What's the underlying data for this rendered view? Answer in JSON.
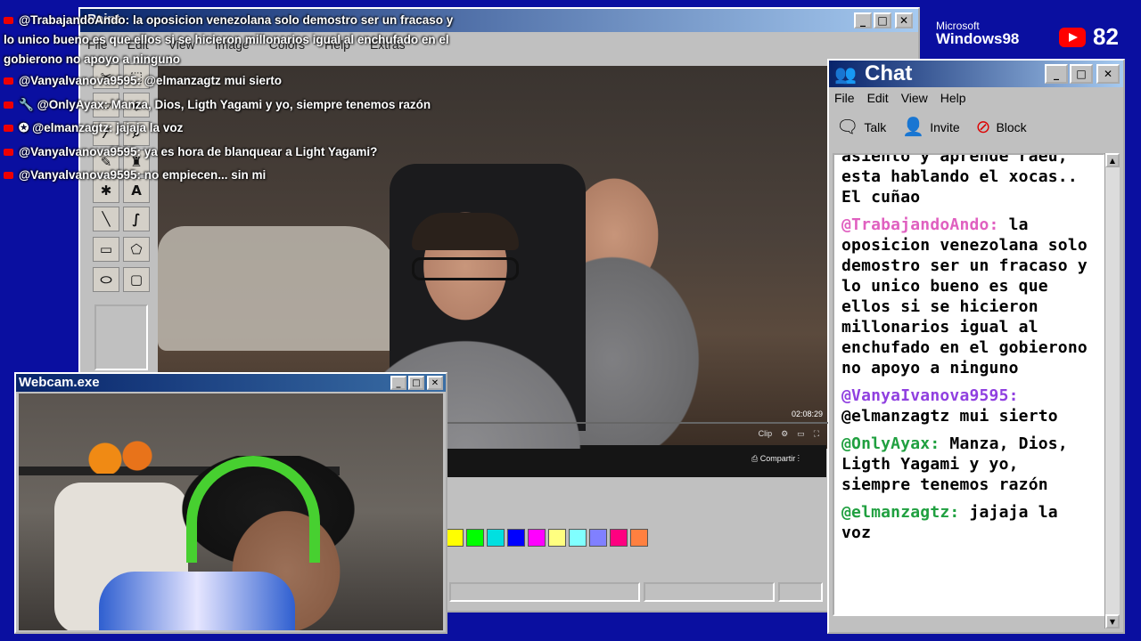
{
  "paint": {
    "title": "Paint",
    "menu": [
      "File",
      "Edit",
      "View",
      "Image",
      "Colors",
      "Help",
      "Extras"
    ],
    "stream": {
      "timecode": "02:08:29",
      "clip_label": "Clip",
      "share_label": "Compartir"
    },
    "palette": [
      "#ffff00",
      "#00ff00",
      "#00e0e0",
      "#0000ff",
      "#ff00ff",
      "#ffff80",
      "#80ffff",
      "#8080ff",
      "#ff0080",
      "#ff8040"
    ]
  },
  "overlay": {
    "messages": [
      {
        "user": "@TrabajandoAndo:",
        "text": "la oposicion venezolana solo demostro ser un fracaso y lo unico bueno es que ellos si se hicieron millonarios igual al enchufado en el gobierono no apoyo a ninguno"
      },
      {
        "user": "@Vanyalvanova9595:",
        "text": "@elmanzagtz mui sierto"
      },
      {
        "user": "@OnlyAyax:",
        "text": "Manza, Dios, Ligth Yagami y yo, siempre tenemos razón"
      },
      {
        "user": "@elmanzagtz:",
        "text": "jajaja la voz"
      },
      {
        "user": "@Vanyalvanova9595:",
        "text": "ya es hora de blanquear a Light Yagami?"
      },
      {
        "user": "@Vanyalvanova9595:",
        "text": "no empiecen... sin mi"
      }
    ]
  },
  "branding": {
    "microsoft": "Microsoft",
    "windows": "Windows98",
    "viewer_count": "82"
  },
  "chat": {
    "title": "Chat",
    "menu": [
      "File",
      "Edit",
      "View",
      "Help"
    ],
    "toolbar": {
      "talk": "Talk",
      "invite": "Invite",
      "block": "Block"
    },
    "log": [
      {
        "user": "",
        "text": "asiento y aprende raeu, esta hablando el xocas.. El cuñao",
        "color": "#000000"
      },
      {
        "user": "@TrabajandoAndo:",
        "text": "la oposicion venezolana solo demostro ser un fracaso y lo unico bueno es que ellos si se hicieron millonarios igual al enchufado en el gobierono no apoyo a ninguno",
        "color": "#e060c0"
      },
      {
        "user": "@VanyaIvanova9595:",
        "text": "@elmanzagtz mui sierto",
        "color": "#9040e0"
      },
      {
        "user": "@OnlyAyax:",
        "text": "Manza, Dios, Ligth Yagami y yo, siempre tenemos razón",
        "color": "#20a040"
      },
      {
        "user": "@elmanzagtz:",
        "text": "jajaja la voz",
        "color": "#20a040"
      }
    ]
  },
  "webcam": {
    "title": "Webcam.exe"
  }
}
